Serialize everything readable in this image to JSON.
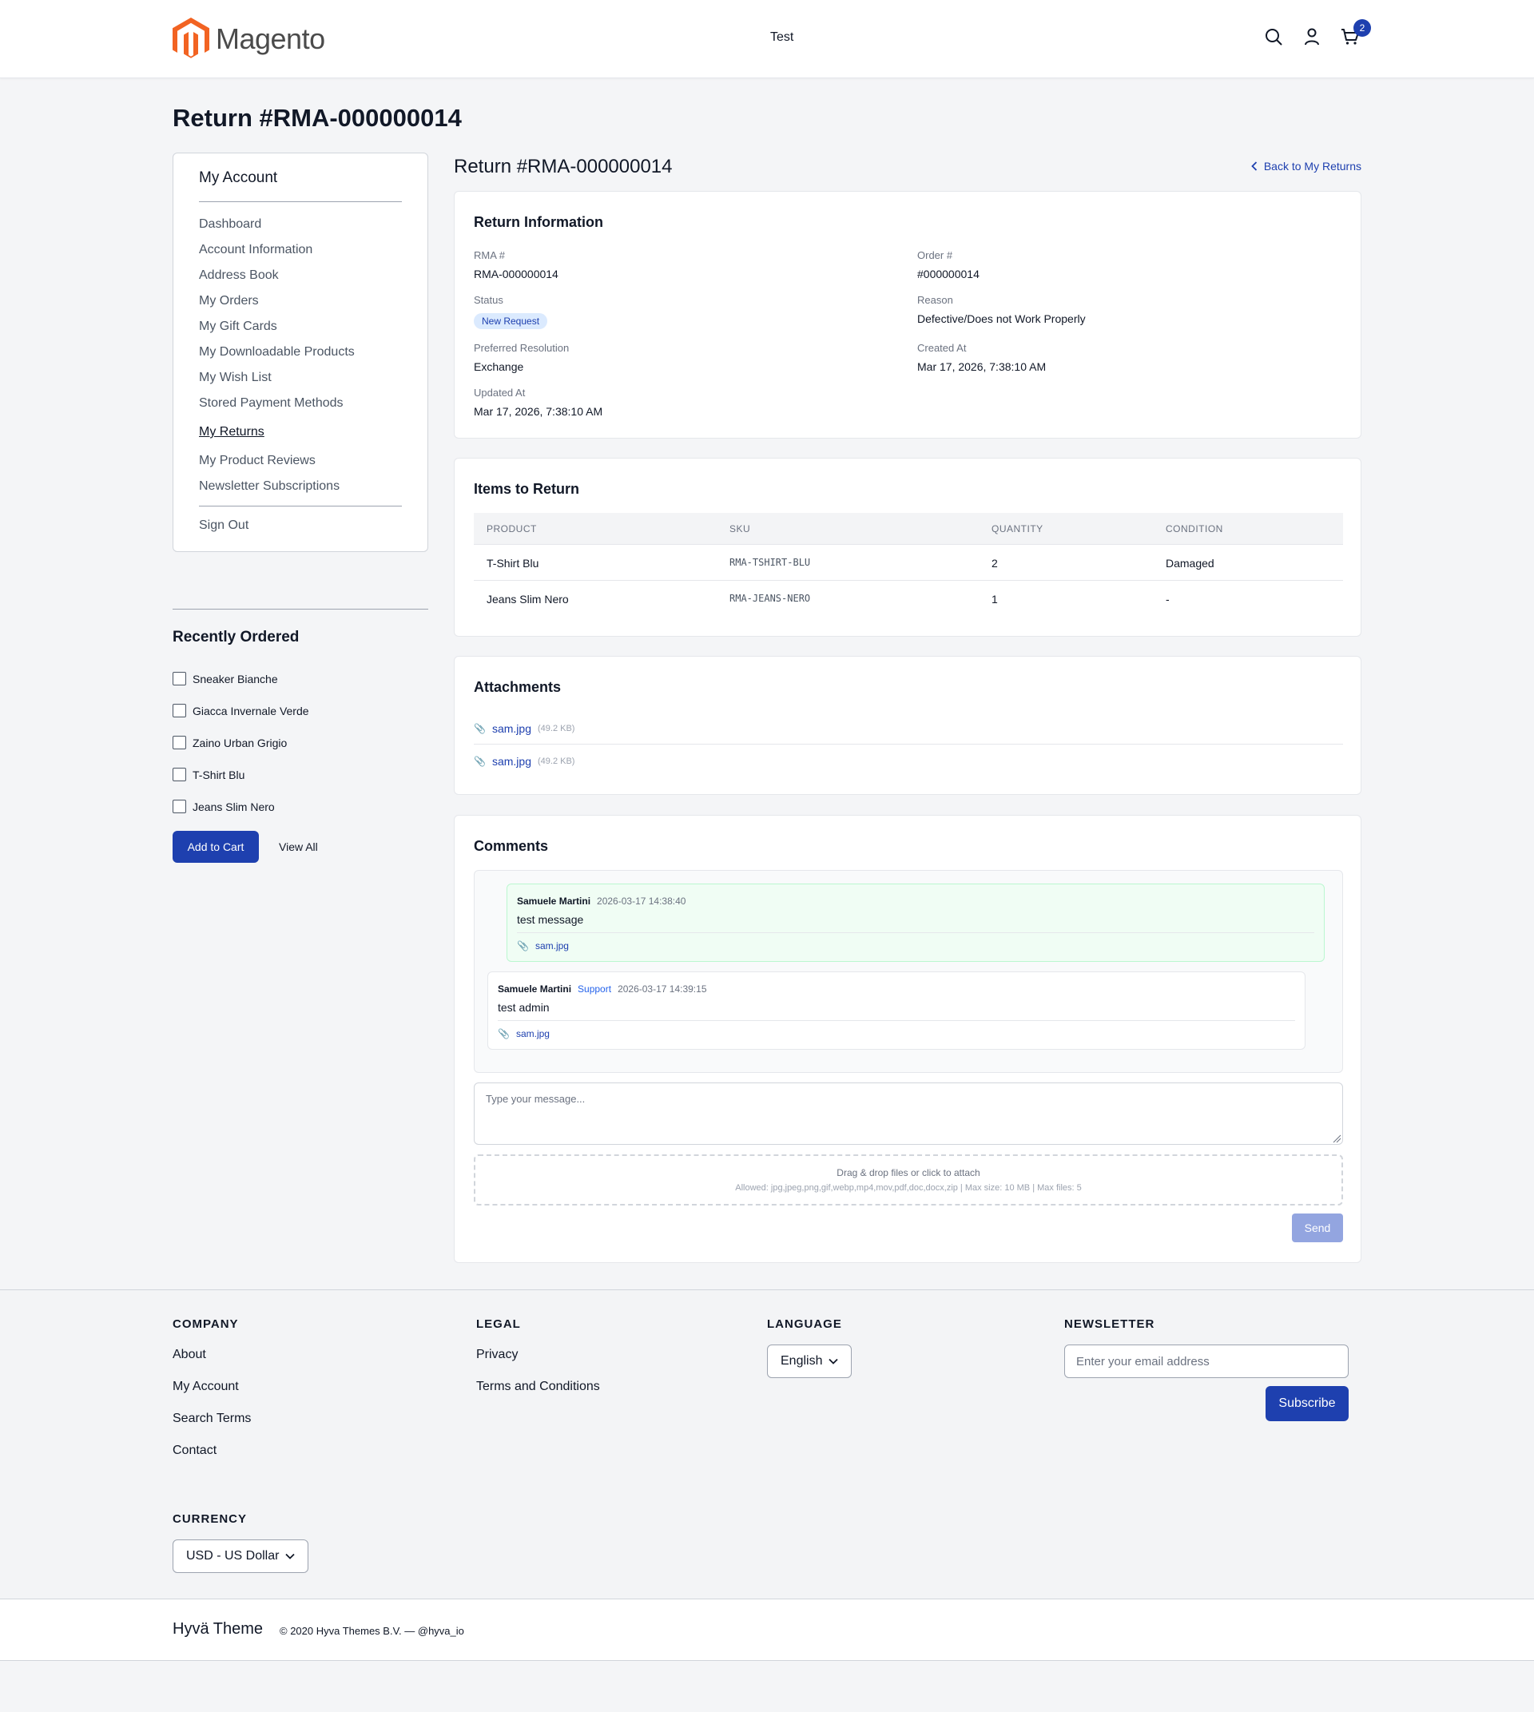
{
  "header": {
    "logo_text": "Magento",
    "store_name": "Test",
    "cart_count": "2"
  },
  "page_title": "Return #RMA-000000014",
  "sidebar": {
    "title": "My Account",
    "items": [
      {
        "label": "Dashboard"
      },
      {
        "label": "Account Information"
      },
      {
        "label": "Address Book"
      },
      {
        "label": "My Orders"
      },
      {
        "label": "My Gift Cards"
      },
      {
        "label": "My Downloadable Products"
      },
      {
        "label": "My Wish List"
      },
      {
        "label": "Stored Payment Methods"
      },
      {
        "label": "My Returns"
      },
      {
        "label": "My Product Reviews"
      },
      {
        "label": "Newsletter Subscriptions"
      }
    ],
    "sign_out": "Sign Out"
  },
  "recently_ordered": {
    "title": "Recently Ordered",
    "items": [
      "Sneaker Bianche",
      "Giacca Invernale Verde",
      "Zaino Urban Grigio",
      "T-Shirt Blu",
      "Jeans Slim Nero"
    ],
    "add_to_cart": "Add to Cart",
    "view_all": "View All"
  },
  "main": {
    "title": "Return #RMA-000000014",
    "back_link": "Back to My Returns",
    "info": {
      "title": "Return Information",
      "rma_label": "RMA #",
      "rma_value": "RMA-000000014",
      "order_label": "Order #",
      "order_value": "#000000014",
      "status_label": "Status",
      "status_value": "New Request",
      "reason_label": "Reason",
      "reason_value": "Defective/Does not Work Properly",
      "resolution_label": "Preferred Resolution",
      "resolution_value": "Exchange",
      "created_label": "Created At",
      "created_value": "Mar 17, 2026, 7:38:10 AM",
      "updated_label": "Updated At",
      "updated_value": "Mar 17, 2026, 7:38:10 AM"
    },
    "items": {
      "title": "Items to Return",
      "columns": [
        "PRODUCT",
        "SKU",
        "QUANTITY",
        "CONDITION"
      ],
      "rows": [
        {
          "product": "T-Shirt Blu",
          "sku": "RMA-TSHIRT-BLU",
          "qty": "2",
          "condition": "Damaged"
        },
        {
          "product": "Jeans Slim Nero",
          "sku": "RMA-JEANS-NERO",
          "qty": "1",
          "condition": "-"
        }
      ]
    },
    "attachments": {
      "title": "Attachments",
      "files": [
        {
          "name": "sam.jpg",
          "size": "(49.2 KB)"
        },
        {
          "name": "sam.jpg",
          "size": "(49.2 KB)"
        }
      ]
    },
    "comments": {
      "title": "Comments",
      "messages": [
        {
          "author": "Samuele Martini",
          "role": "",
          "time": "2026-03-17 14:38:40",
          "text": "test message",
          "attachment": "sam.jpg"
        },
        {
          "author": "Samuele Martini",
          "role": "Support",
          "time": "2026-03-17 14:39:15",
          "text": "test admin",
          "attachment": "sam.jpg"
        }
      ],
      "placeholder": "Type your message...",
      "dropzone_main": "Drag & drop files or click to attach",
      "dropzone_sub": "Allowed: jpg,jpeg,png,gif,webp,mp4,mov,pdf,doc,docx,zip | Max size: 10 MB | Max files: 5",
      "send": "Send"
    }
  },
  "footer": {
    "company": {
      "title": "COMPANY",
      "links": [
        "About",
        "My Account",
        "Search Terms",
        "Contact"
      ]
    },
    "legal": {
      "title": "LEGAL",
      "links": [
        "Privacy",
        "Terms and Conditions"
      ]
    },
    "language": {
      "title": "LANGUAGE",
      "value": "English"
    },
    "newsletter": {
      "title": "NEWSLETTER",
      "placeholder": "Enter your email address",
      "button": "Subscribe"
    },
    "currency": {
      "title": "CURRENCY",
      "value": "USD - US Dollar"
    },
    "brand": "Hyvä Theme",
    "copyright": "© 2020 Hyva Themes B.V. — @hyva_io"
  },
  "colors": {
    "accent": "#1e40af",
    "logo_orange": "#f26322"
  }
}
